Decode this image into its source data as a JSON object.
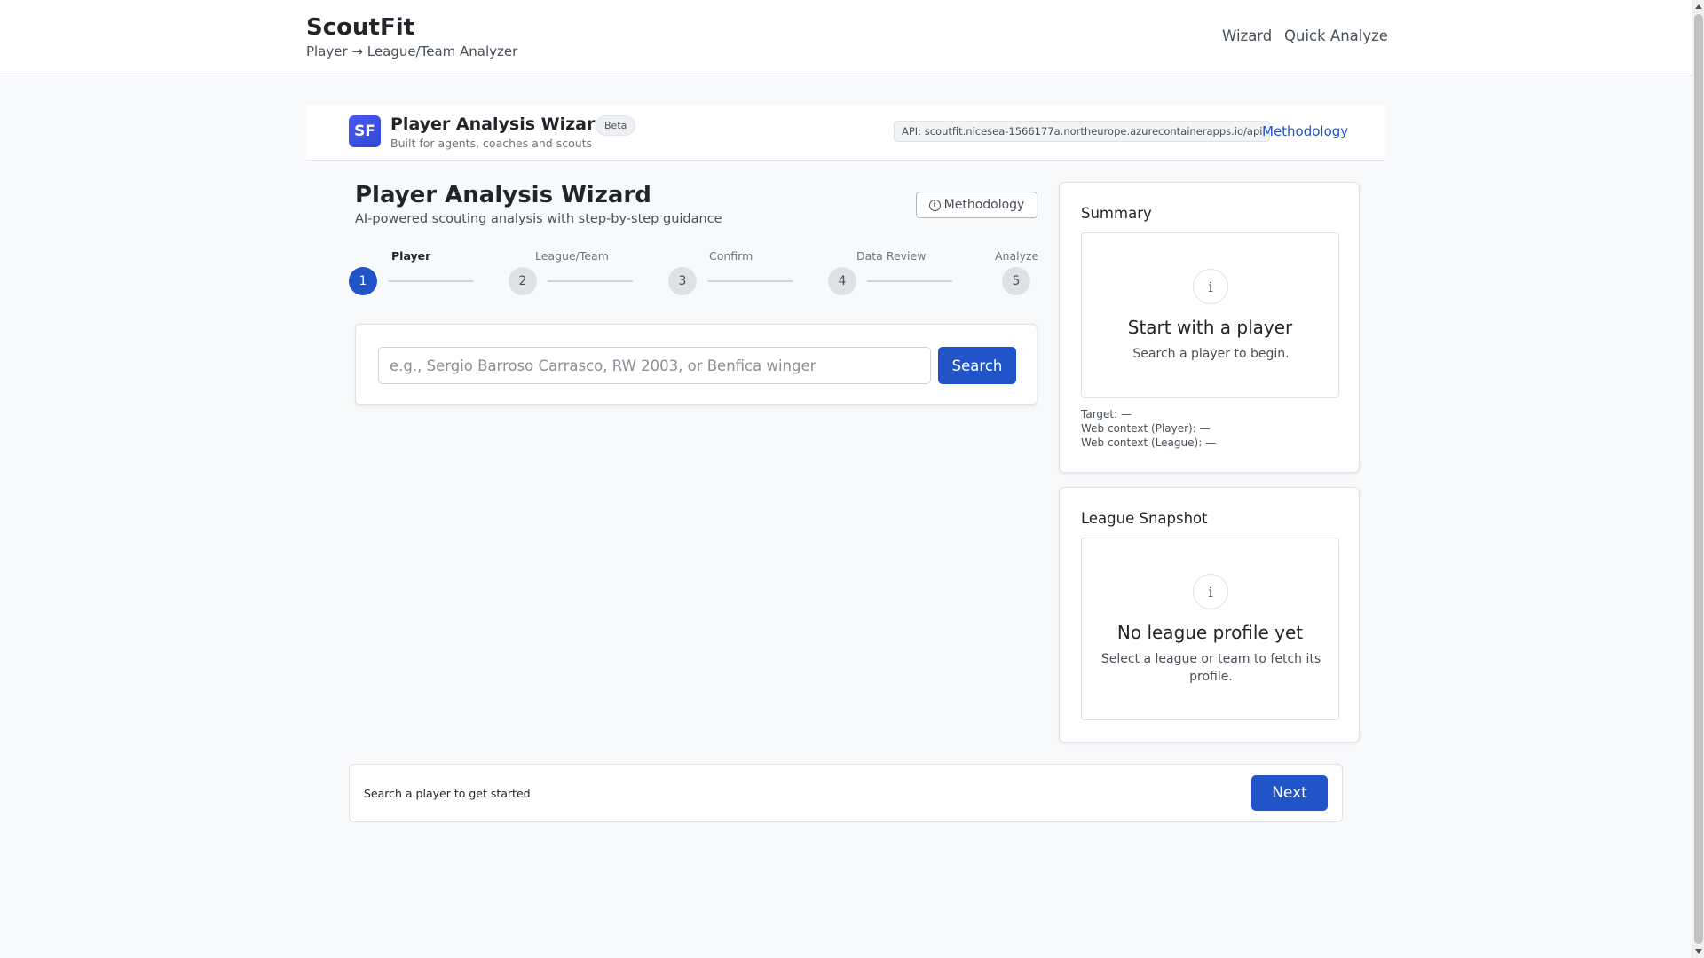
{
  "navbar": {
    "brand": "ScoutFit",
    "tagline": "Player → League/Team Analyzer",
    "links": {
      "wizard": "Wizard",
      "quick_analyze": "Quick Analyze"
    }
  },
  "subheader": {
    "logo_text": "SF",
    "title": "Player Analysis Wizard",
    "badge": "Beta",
    "subtitle": "Built for agents, coaches and scouts",
    "api": "API: scoutfit.nicesea-1566177a.northeurope.azurecontainerapps.io/api",
    "methodology_link": "Methodology"
  },
  "main": {
    "title": "Player Analysis Wizard",
    "subtitle": "AI-powered scouting analysis with step-by-step guidance",
    "methodology_button": "Methodology",
    "steps": [
      {
        "number": "1",
        "label": "Player"
      },
      {
        "number": "2",
        "label": "League/Team"
      },
      {
        "number": "3",
        "label": "Confirm"
      },
      {
        "number": "4",
        "label": "Data Review"
      },
      {
        "number": "5",
        "label": "Analyze"
      }
    ],
    "active_step": 1,
    "search": {
      "value": "",
      "placeholder": "e.g., Sergio Barroso Carrasco, RW 2003, or Benfica winger",
      "button": "Search"
    }
  },
  "summary": {
    "title": "Summary",
    "empty_icon": "i",
    "empty_title": "Start with a player",
    "empty_desc": "Search a player to begin.",
    "target": "Target: —",
    "web_player": "Web context (Player): —",
    "web_league": "Web context (League): —"
  },
  "league_snapshot": {
    "title": "League Snapshot",
    "empty_icon": "i",
    "empty_title": "No league profile yet",
    "empty_desc": "Select a league or team to fetch its profile."
  },
  "footer": {
    "status": "Search a player to get started",
    "next_button": "Next"
  },
  "colors": {
    "primary": "#2154c9",
    "logo": "#3d50e6",
    "background": "#f8f9fa"
  },
  "icons": [
    "info-icon",
    "logo-icon"
  ]
}
